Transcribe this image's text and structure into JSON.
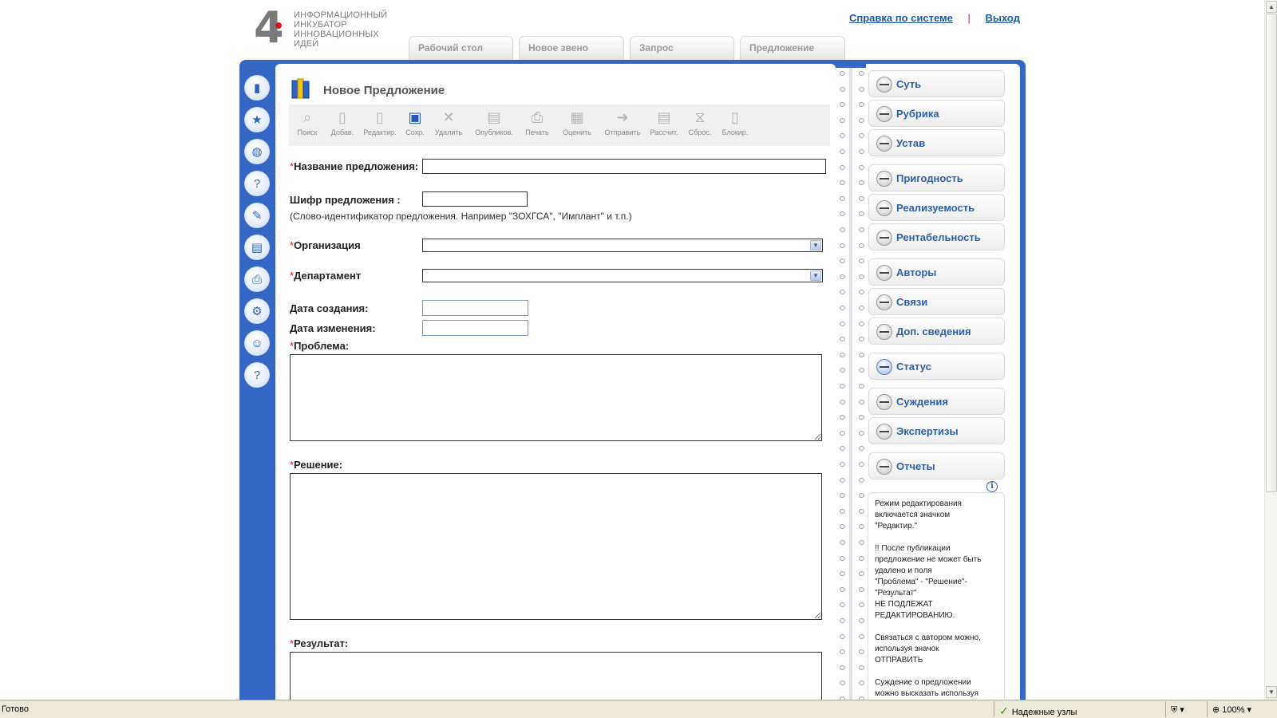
{
  "logo": {
    "lines": [
      "ИНФОРМАЦИОННЫЙ",
      "ИНКУБАТОР",
      "ИННОВАЦИОННЫХ",
      "ИДЕЙ"
    ],
    "mark": "4"
  },
  "header": {
    "help_link": "Справка по системе",
    "separator": "|",
    "logout_link": "Выход"
  },
  "tabs": [
    {
      "label": "Рабочий стол"
    },
    {
      "label": "Новое звено"
    },
    {
      "label": "Запрос"
    },
    {
      "label": "Предложение",
      "active": true
    }
  ],
  "page": {
    "title": "Новое Предложение"
  },
  "toolbar": [
    {
      "label": "Поиск",
      "icon": "search-icon"
    },
    {
      "label": "Добав.",
      "icon": "add-icon"
    },
    {
      "label": "Редактир.",
      "icon": "edit-icon"
    },
    {
      "label": "Сохр.",
      "icon": "save-icon"
    },
    {
      "label": "Удалить",
      "icon": "delete-icon"
    },
    {
      "label": "Опубликов.",
      "icon": "publish-icon"
    },
    {
      "label": "Печать",
      "icon": "print-icon"
    },
    {
      "label": "Оценить",
      "icon": "rate-icon"
    },
    {
      "label": "Отправить",
      "icon": "send-icon"
    },
    {
      "label": "Рассчит.",
      "icon": "calculate-icon"
    },
    {
      "label": "Сброс.",
      "icon": "reset-icon"
    },
    {
      "label": "Блокир.",
      "icon": "lock-icon"
    }
  ],
  "form": {
    "required_mark": "*",
    "name_label": "Название предложения:",
    "code_label": "Шифр предложения :",
    "code_hint": "(Слово-идентификатор предложения. Например \"ЗОХГСА\", \"Имплант\" и т.п.)",
    "org_label": "Организация",
    "dept_label": "Департамент",
    "created_label": "Дата создания:",
    "modified_label": "Дата изменения:",
    "problem_label": "Проблема:",
    "solution_label": "Решение:",
    "result_label": "Результат:"
  },
  "sidebar": {
    "items": [
      {
        "label": "Суть"
      },
      {
        "label": "Рубрика"
      },
      {
        "label": "Устав"
      },
      {
        "label": "Пригодность"
      },
      {
        "label": "Реализуемость"
      },
      {
        "label": "Рентабельность"
      },
      {
        "label": "Авторы"
      },
      {
        "label": "Связи"
      },
      {
        "label": "Доп. сведения"
      },
      {
        "label": "Статус",
        "active": true
      },
      {
        "label": "Суждения"
      },
      {
        "label": "Экспертизы"
      },
      {
        "label": "Отчеты"
      }
    ],
    "info_icon": "i",
    "info_paragraphs": [
      "Режим редактирования\nвключается значком\n\"Редактир.\"",
      "!! После публикации\nпредложение не может быть\nудалено и поля\n\"Проблема\" - \"Решение\"-\n\"Результат\"\nНЕ ПОДЛЕЖАТ\nРЕДАКТИРОВАНИЮ.",
      "Связаться с автором можно,\nиспользуя значок\nОТПРАВИТЬ",
      "Суждение о предложении\nможно высказать используя"
    ]
  },
  "leftnav_icons": [
    "book-icon",
    "folder-star-icon",
    "globe-icon",
    "question-icon",
    "edit-doc-icon",
    "books-icon",
    "printer-icon",
    "settings-icon",
    "user-icon",
    "help-icon"
  ],
  "statusbar": {
    "status": "Готово",
    "zone": "Надежные узлы",
    "zoom": "100%"
  },
  "colors": {
    "frame_blue": "#3466c4",
    "link_blue": "#1c5aa6",
    "required_red": "#d9141b"
  }
}
